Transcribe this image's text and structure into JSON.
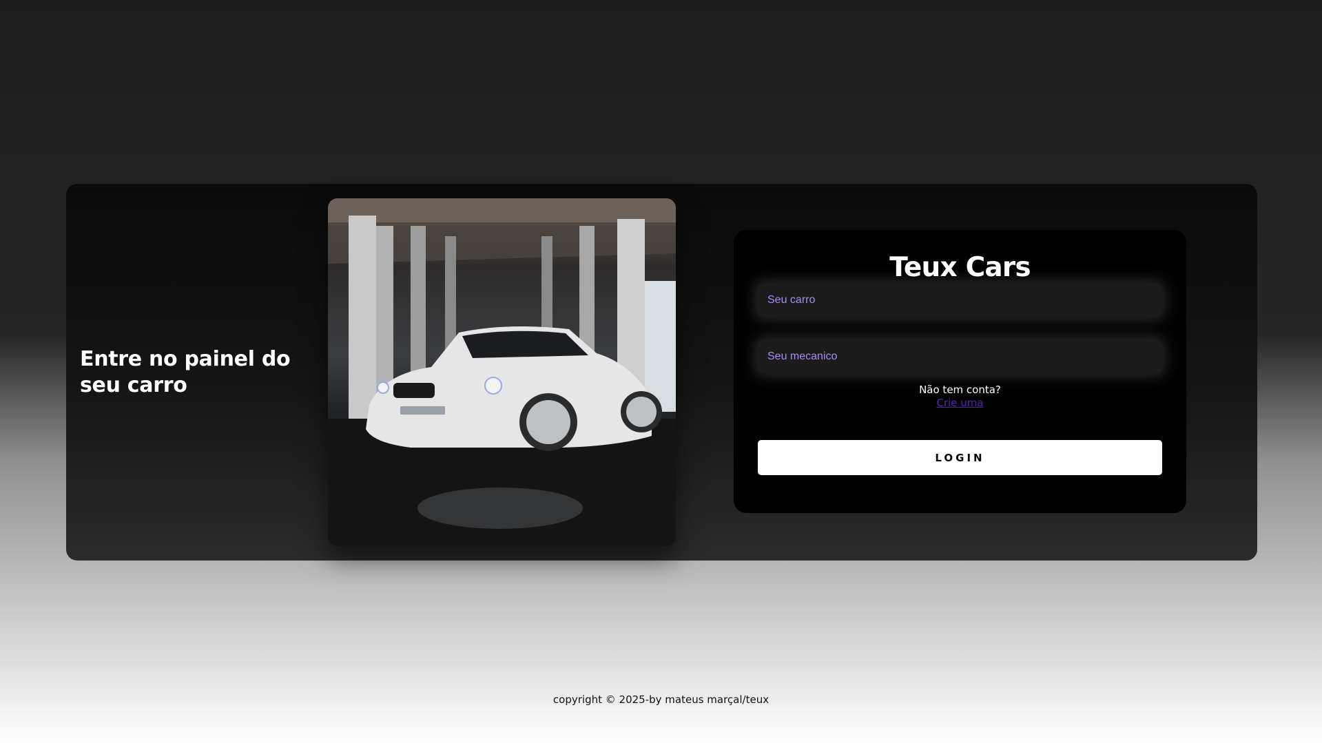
{
  "hero": {
    "headline": "Entre no painel do seu carro",
    "image_alt": "white-sedan-photo"
  },
  "login": {
    "title": "Teux Cars",
    "car_placeholder": "Seu carro",
    "mechanic_placeholder": "Seu mecanico",
    "no_account_text": "Não tem conta?",
    "signup_link": "Crie uma",
    "button_label": "LOGIN"
  },
  "footer": {
    "copyright": "copyright © 2025-by mateus marçal/teux"
  },
  "colors": {
    "placeholder": "#a78bfa",
    "link": "#5b21b6",
    "panel": "#000000",
    "button": "#ffffff"
  }
}
